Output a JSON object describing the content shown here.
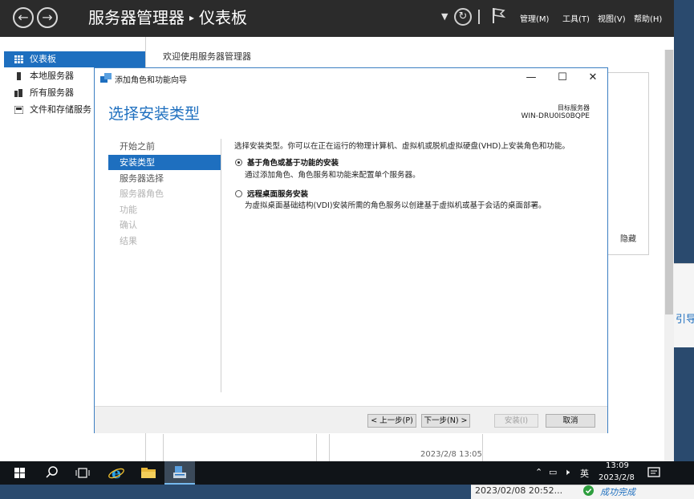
{
  "server_manager": {
    "title": "服务器管理器",
    "title_separator": "▸",
    "page": "仪表板",
    "menu": [
      "管理(M)",
      "工具(T)",
      "视图(V)",
      "帮助(H)"
    ],
    "sidebar": [
      {
        "label": "仪表板",
        "active": true
      },
      {
        "label": "本地服务器",
        "active": false
      },
      {
        "label": "所有服务器",
        "active": false
      },
      {
        "label": "文件和存储服务",
        "active": false
      }
    ],
    "welcome": "欢迎使用服务器管理器",
    "hide_label": "隐藏",
    "tile_timestamp": "2023/2/8 13:05"
  },
  "wizard": {
    "window_title": "添加角色和功能向导",
    "heading": "选择安装类型",
    "target_label": "目标服务器",
    "target_value": "WIN-DRU0IS0BQPE",
    "steps": [
      {
        "label": "开始之前",
        "state": "done"
      },
      {
        "label": "安装类型",
        "state": "active"
      },
      {
        "label": "服务器选择",
        "state": "done"
      },
      {
        "label": "服务器角色",
        "state": "disabled"
      },
      {
        "label": "功能",
        "state": "disabled"
      },
      {
        "label": "确认",
        "state": "disabled"
      },
      {
        "label": "结果",
        "state": "disabled"
      }
    ],
    "intro": "选择安装类型。你可以在正在运行的物理计算机、虚拟机或脱机虚拟硬盘(VHD)上安装角色和功能。",
    "options": [
      {
        "title": "基于角色或基于功能的安装",
        "desc": "通过添加角色、角色服务和功能来配置单个服务器。",
        "checked": true
      },
      {
        "title": "远程桌面服务安装",
        "desc": "为虚拟桌面基础结构(VDI)安装所需的角色服务以创建基于虚拟机或基于会话的桌面部署。",
        "checked": false
      }
    ],
    "buttons": {
      "prev": "< 上一步(P)",
      "next": "下一步(N) >",
      "install": "安装(I)",
      "cancel": "取消"
    }
  },
  "taskbar": {
    "time": "13:09",
    "date": "2023/2/8",
    "ime": "英"
  },
  "notification": {
    "timestamp": "2023/02/08 20:52...",
    "status": "成功完成"
  },
  "background_window_text": "引导",
  "colors": {
    "accent": "#1e6fbf",
    "titlebar": "#2b2b2b",
    "taskbar": "#101418",
    "success": "#2e9e3e"
  }
}
